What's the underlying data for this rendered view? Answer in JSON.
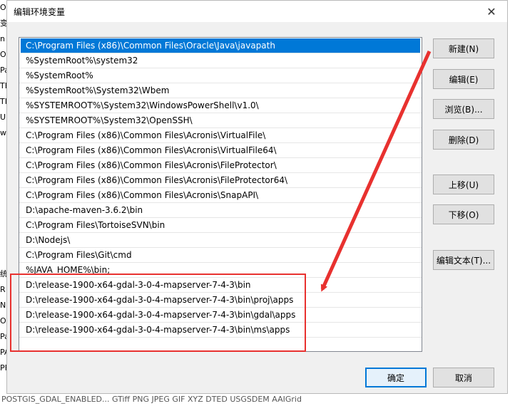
{
  "dialog": {
    "title": "编辑环境变量",
    "close_label": "✕"
  },
  "path_entries": [
    "C:\\Program Files (x86)\\Common Files\\Oracle\\Java\\javapath",
    "%SystemRoot%\\system32",
    "%SystemRoot%",
    "%SystemRoot%\\System32\\Wbem",
    "%SYSTEMROOT%\\System32\\WindowsPowerShell\\v1.0\\",
    "%SYSTEMROOT%\\System32\\OpenSSH\\",
    "C:\\Program Files (x86)\\Common Files\\Acronis\\VirtualFile\\",
    "C:\\Program Files (x86)\\Common Files\\Acronis\\VirtualFile64\\",
    "C:\\Program Files (x86)\\Common Files\\Acronis\\FileProtector\\",
    "C:\\Program Files (x86)\\Common Files\\Acronis\\FileProtector64\\",
    "C:\\Program Files (x86)\\Common Files\\Acronis\\SnapAPI\\",
    "D:\\apache-maven-3.6.2\\bin",
    "C:\\Program Files\\TortoiseSVN\\bin",
    "D:\\Nodejs\\",
    "C:\\Program Files\\Git\\cmd",
    "%JAVA_HOME%\\bin;",
    "D:\\release-1900-x64-gdal-3-0-4-mapserver-7-4-3\\bin",
    "D:\\release-1900-x64-gdal-3-0-4-mapserver-7-4-3\\bin\\proj\\apps",
    "D:\\release-1900-x64-gdal-3-0-4-mapserver-7-4-3\\bin\\gdal\\apps",
    "D:\\release-1900-x64-gdal-3-0-4-mapserver-7-4-3\\bin\\ms\\apps"
  ],
  "buttons": {
    "new": "新建(N)",
    "edit": "编辑(E)",
    "browse": "浏览(B)...",
    "delete": "删除(D)",
    "move_up": "上移(U)",
    "move_down": "下移(O)",
    "edit_text": "编辑文本(T)...",
    "ok": "确定",
    "cancel": "取消"
  },
  "background": {
    "edge_fragments": [
      "O",
      "变",
      "n",
      "O",
      "Pa",
      "TE",
      "TI",
      "U",
      "w",
      "",
      "",
      "",
      "",
      "",
      "",
      "",
      "",
      "统",
      "R",
      "N",
      "O",
      "Pa",
      "PA",
      "PF"
    ],
    "bottom_text": "POSTGIS_GDAL_ENABLED... GTiff PNG JPEG GIF XYZ DTED USGSDEM AAIGrid"
  },
  "annotation": {
    "color": "#e8312f"
  }
}
